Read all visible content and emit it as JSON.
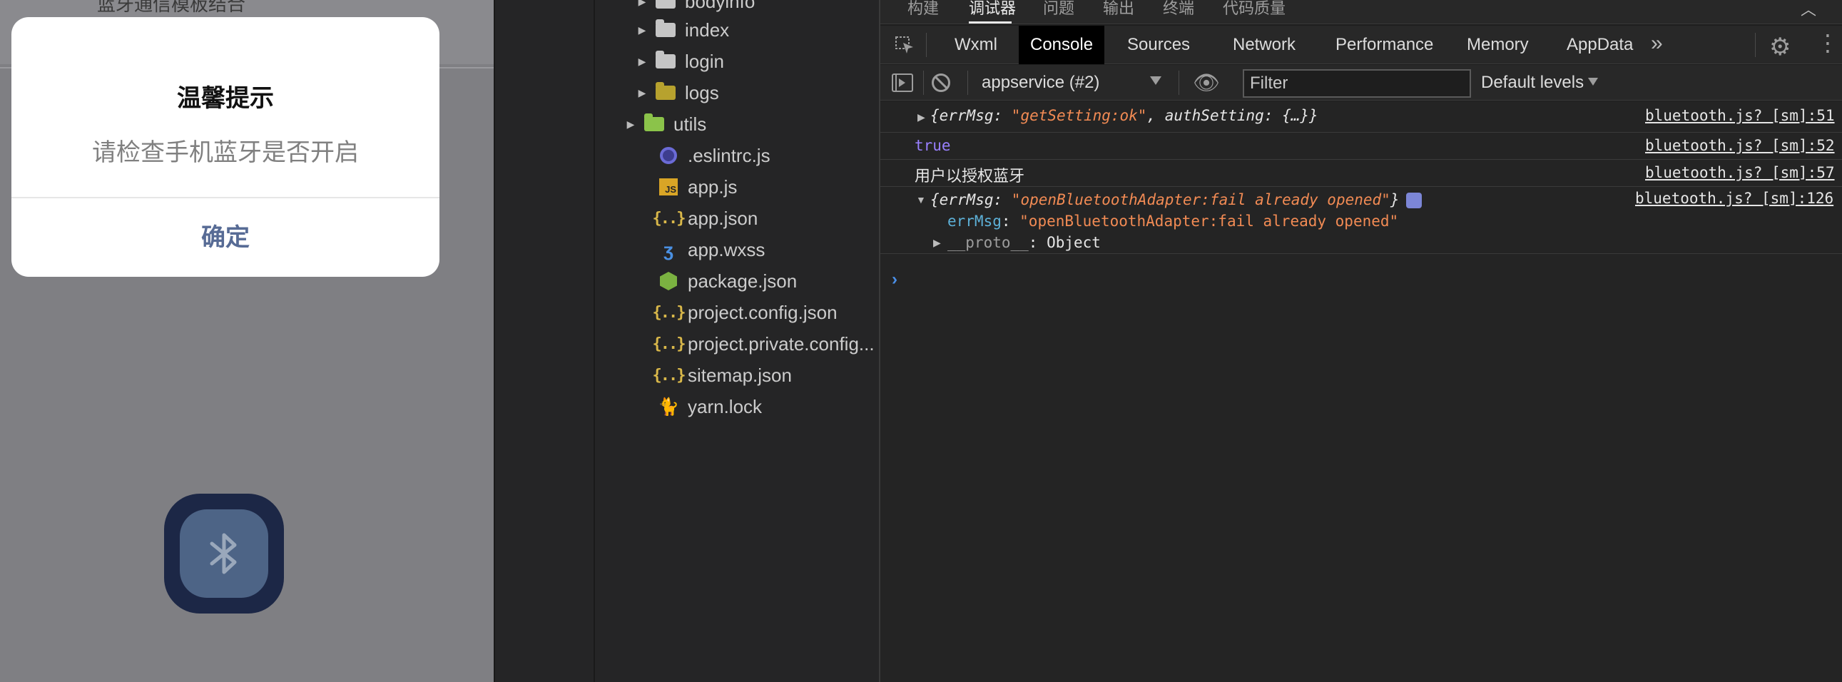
{
  "simulator": {
    "topbar_text": "蓝牙通信模板结合",
    "modal": {
      "title": "温馨提示",
      "content": "请检查手机蓝牙是否开启",
      "confirm": "确定"
    },
    "bluetooth_icon": "bluetooth-icon"
  },
  "explorer": {
    "items": [
      {
        "label": "bodyinfo",
        "icon": "folder-icon",
        "expandable": true
      },
      {
        "label": "index",
        "icon": "folder-icon",
        "expandable": true
      },
      {
        "label": "login",
        "icon": "folder-icon",
        "expandable": true
      },
      {
        "label": "logs",
        "icon": "folder-logs-icon",
        "expandable": true
      },
      {
        "label": "utils",
        "icon": "folder-utils-icon",
        "expandable": true
      },
      {
        "label": ".eslintrc.js",
        "icon": "eslint-icon"
      },
      {
        "label": "app.js",
        "icon": "js-file-icon"
      },
      {
        "label": "app.json",
        "icon": "json-file-icon"
      },
      {
        "label": "app.wxss",
        "icon": "wxss-file-icon"
      },
      {
        "label": "package.json",
        "icon": "npm-package-icon"
      },
      {
        "label": "project.config.json",
        "icon": "json-file-icon"
      },
      {
        "label": "project.private.config...",
        "icon": "json-file-icon"
      },
      {
        "label": "sitemap.json",
        "icon": "json-file-icon"
      },
      {
        "label": "yarn.lock",
        "icon": "yarn-icon"
      }
    ]
  },
  "devtools": {
    "top_tabs": [
      "构建",
      "调试器",
      "问题",
      "输出",
      "终端",
      "代码质量"
    ],
    "active_top_tab": "调试器",
    "panel_tabs": [
      "Wxml",
      "Console",
      "Sources",
      "Network",
      "Performance",
      "Memory",
      "AppData"
    ],
    "active_panel_tab": "Console",
    "context": "appservice (#2)",
    "filter_placeholder": "Filter",
    "levels": "Default levels",
    "logs": {
      "row1": {
        "prefix": "{errMsg: ",
        "str": "\"getSetting:ok\"",
        "suffix": ", authSetting: {…}}",
        "source": "bluetooth.js? [sm]:51"
      },
      "row2": {
        "text": "true",
        "source": "bluetooth.js? [sm]:52"
      },
      "row3": {
        "text": "用户以授权蓝牙",
        "source": "bluetooth.js? [sm]:57"
      },
      "row4": {
        "prefix": "{errMsg: ",
        "str": "\"openBluetoothAdapter:fail already opened\"",
        "suffix": "}",
        "source": "bluetooth.js? [sm]:126",
        "prop_key": "errMsg",
        "prop_sep": ": ",
        "prop_val": "\"openBluetoothAdapter:fail already opened\"",
        "proto_key": "__proto__",
        "proto_sep": ": ",
        "proto_val": "Object"
      }
    },
    "prompt": "›"
  }
}
